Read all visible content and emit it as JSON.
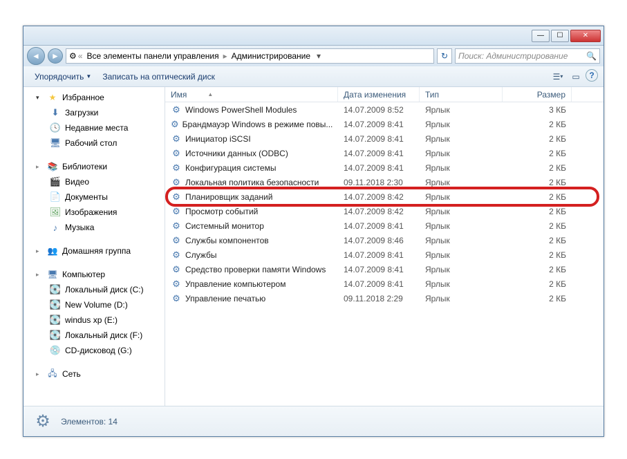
{
  "titlebar": {
    "minimize": "—",
    "maximize": "☐",
    "close": "✕"
  },
  "addrbar": {
    "back": "◄",
    "forward": "►",
    "crumb1": "Все элементы панели управления",
    "crumb2": "Администрирование",
    "refresh": "↻",
    "search_placeholder": "Поиск: Администрирование",
    "search_icon": "🔍"
  },
  "toolbar": {
    "organize": "Упорядочить",
    "burn": "Записать на оптический диск",
    "view_icon": "☰",
    "preview_icon": "▭",
    "help_icon": "?"
  },
  "sidebar": {
    "favorites": {
      "label": "Избранное",
      "items": [
        {
          "icon": "⬇",
          "label": "Загрузки",
          "cls": "blue-ico"
        },
        {
          "icon": "🕓",
          "label": "Недавние места",
          "cls": "folder-ico"
        },
        {
          "icon": "🖥",
          "label": "Рабочий стол",
          "cls": "blue-ico"
        }
      ]
    },
    "libraries": {
      "label": "Библиотеки",
      "items": [
        {
          "icon": "🎬",
          "label": "Видео",
          "cls": "blue-ico"
        },
        {
          "icon": "📄",
          "label": "Документы",
          "cls": "folder-ico"
        },
        {
          "icon": "🖼",
          "label": "Изображения",
          "cls": "green-ico"
        },
        {
          "icon": "♪",
          "label": "Музыка",
          "cls": "blue-ico"
        }
      ]
    },
    "homegroup": {
      "icon": "👥",
      "label": "Домашняя группа"
    },
    "computer": {
      "label": "Компьютер",
      "items": [
        {
          "icon": "💽",
          "label": "Локальный диск (C:)"
        },
        {
          "icon": "💽",
          "label": "New Volume (D:)"
        },
        {
          "icon": "💽",
          "label": "windus xp (E:)"
        },
        {
          "icon": "💽",
          "label": "Локальный диск (F:)"
        },
        {
          "icon": "💿",
          "label": "CD-дисковод (G:)"
        }
      ]
    },
    "network": {
      "icon": "🖧",
      "label": "Сеть"
    }
  },
  "columns": {
    "name": "Имя",
    "date": "Дата изменения",
    "type": "Тип",
    "size": "Размер"
  },
  "files": [
    {
      "name": "Windows PowerShell Modules",
      "date": "14.07.2009 8:52",
      "type": "Ярлык",
      "size": "3 КБ",
      "hl": false
    },
    {
      "name": "Брандмауэр Windows в режиме повы...",
      "date": "14.07.2009 8:41",
      "type": "Ярлык",
      "size": "2 КБ",
      "hl": false
    },
    {
      "name": "Инициатор iSCSI",
      "date": "14.07.2009 8:41",
      "type": "Ярлык",
      "size": "2 КБ",
      "hl": false
    },
    {
      "name": "Источники данных (ODBC)",
      "date": "14.07.2009 8:41",
      "type": "Ярлык",
      "size": "2 КБ",
      "hl": false
    },
    {
      "name": "Конфигурация системы",
      "date": "14.07.2009 8:41",
      "type": "Ярлык",
      "size": "2 КБ",
      "hl": false
    },
    {
      "name": "Локальная политика безопасности",
      "date": "09.11.2018 2:30",
      "type": "Ярлык",
      "size": "2 КБ",
      "hl": false
    },
    {
      "name": "Планировщик заданий",
      "date": "14.07.2009 8:42",
      "type": "Ярлык",
      "size": "2 КБ",
      "hl": true
    },
    {
      "name": "Просмотр событий",
      "date": "14.07.2009 8:42",
      "type": "Ярлык",
      "size": "2 КБ",
      "hl": false
    },
    {
      "name": "Системный монитор",
      "date": "14.07.2009 8:41",
      "type": "Ярлык",
      "size": "2 КБ",
      "hl": false
    },
    {
      "name": "Службы компонентов",
      "date": "14.07.2009 8:46",
      "type": "Ярлык",
      "size": "2 КБ",
      "hl": false
    },
    {
      "name": "Службы",
      "date": "14.07.2009 8:41",
      "type": "Ярлык",
      "size": "2 КБ",
      "hl": false
    },
    {
      "name": "Средство проверки памяти Windows",
      "date": "14.07.2009 8:41",
      "type": "Ярлык",
      "size": "2 КБ",
      "hl": false
    },
    {
      "name": "Управление компьютером",
      "date": "14.07.2009 8:41",
      "type": "Ярлык",
      "size": "2 КБ",
      "hl": false
    },
    {
      "name": "Управление печатью",
      "date": "09.11.2018 2:29",
      "type": "Ярлык",
      "size": "2 КБ",
      "hl": false
    }
  ],
  "statusbar": {
    "count_label": "Элементов: 14"
  }
}
